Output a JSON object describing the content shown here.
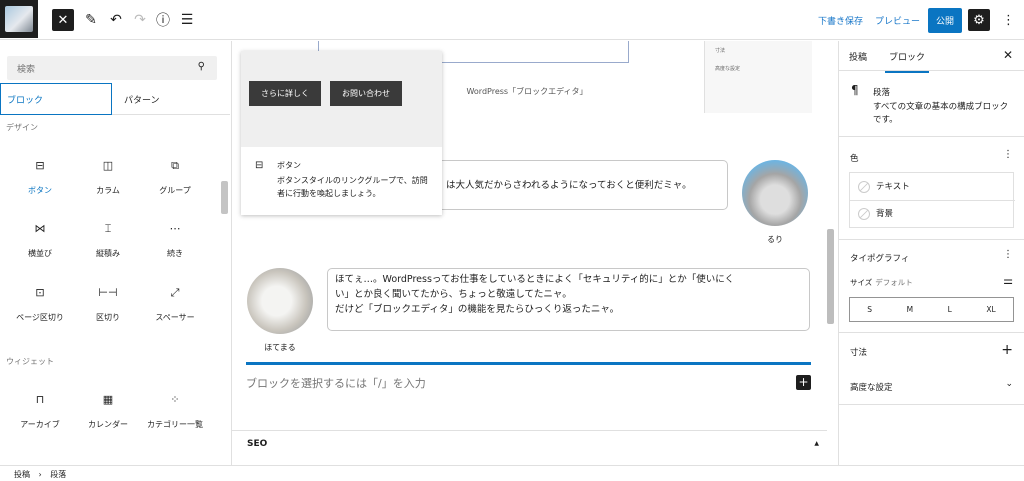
{
  "header": {
    "save_draft": "下書き保存",
    "preview": "プレビュー",
    "publish": "公開",
    "icons": [
      "close-icon",
      "pencil-icon",
      "undo-icon",
      "redo-icon",
      "info-icon",
      "list-view-icon",
      "gear-icon",
      "more-icon"
    ]
  },
  "inserter": {
    "search_placeholder": "検索",
    "tabs": [
      "ブロック",
      "パターン"
    ],
    "category_design": "デザイン",
    "design_blocks": [
      "ボタン",
      "カラム",
      "グループ",
      "横並び",
      "縦積み",
      "続き",
      "ページ区切り",
      "区切り",
      "スペーサー"
    ],
    "category_widgets": "ウィジェット",
    "widget_blocks": [
      "アーカイブ",
      "カレンダー",
      "カテゴリー一覧"
    ]
  },
  "popover": {
    "preview_buttons": [
      "さらに詳しく",
      "お問い合わせ"
    ],
    "title": "ボタン",
    "description": "ボタンスタイルのリンクグループで、訪問者に行動を喚起しましょう。"
  },
  "canvas": {
    "stub_labels": [
      "寸法",
      "高度な設定"
    ],
    "caption": "WordPress「ブロックエディタ」",
    "bubble1": "は大人気だからさわれるようになっておくと便利だミャ。",
    "avatar1_name": "るり",
    "bubble2_line1": "ほてぇ…。WordPressってお仕事をしているときによく「セキュリティ的に」とか「使いにく",
    "bubble2_line2": "い」とか良く聞いてたから、ちょっと敬遠してたニャ。",
    "bubble2_line3": "だけど「ブロックエディタ」の機能を見たらひっくり返ったニャ。",
    "avatar2_name": "ほてまる",
    "appender_placeholder": "ブロックを選択するには「/」を入力",
    "seo_label": "SEO"
  },
  "sidebar": {
    "tabs": [
      "投稿",
      "ブロック"
    ],
    "block_title": "段落",
    "block_desc": "すべての文章の基本の構成ブロックです。",
    "color_title": "色",
    "color_items": [
      "テキスト",
      "背景"
    ],
    "typo_title": "タイポグラフィ",
    "size_label": "サイズ",
    "size_default": "デフォルト",
    "sizes": [
      "S",
      "M",
      "L",
      "XL"
    ],
    "dimensions": "寸法",
    "advanced": "高度な設定"
  },
  "footer": {
    "crumbs": [
      "投稿",
      "段落"
    ]
  },
  "colors": {
    "accent": "#0a75c2",
    "dark": "#1e1e1e"
  }
}
